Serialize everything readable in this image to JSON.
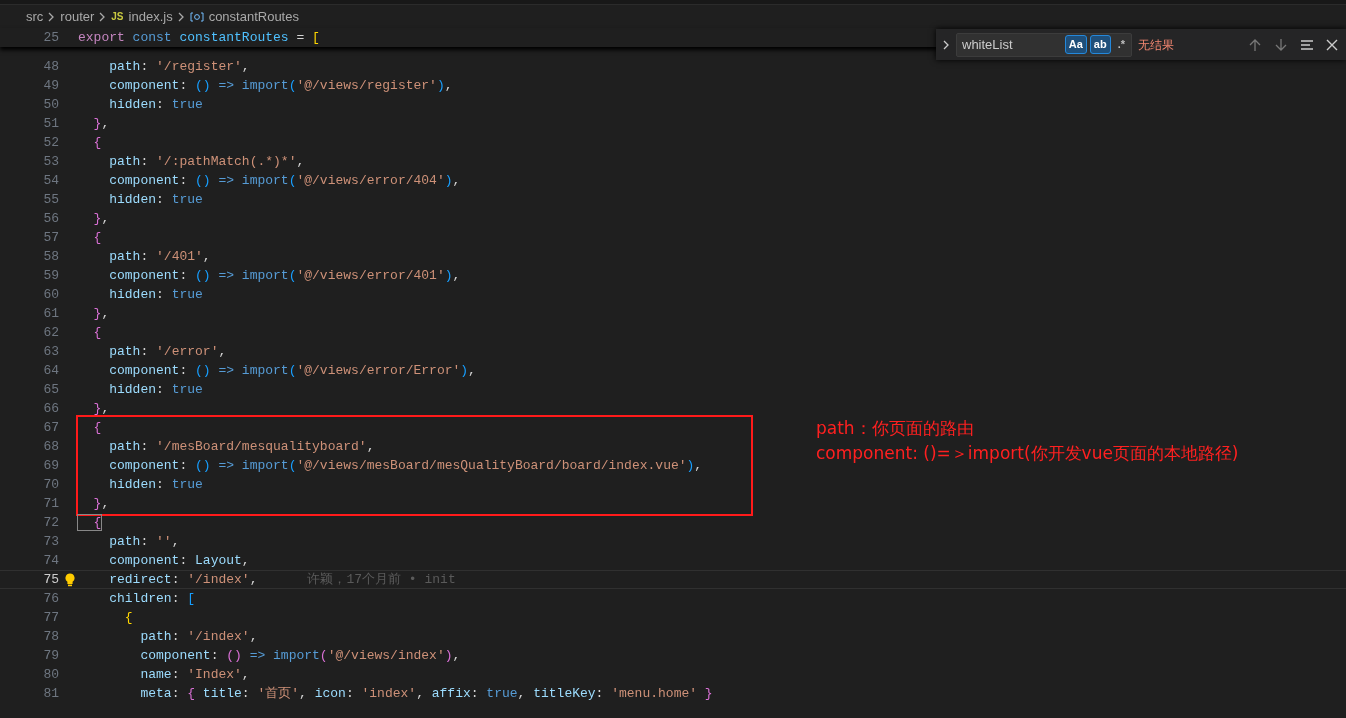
{
  "breadcrumb": [
    {
      "label": "src",
      "kind": "folder"
    },
    {
      "label": "router",
      "kind": "folder"
    },
    {
      "label": "index.js",
      "kind": "file",
      "badge": "JS"
    },
    {
      "label": "constantRoutes",
      "kind": "symbol"
    }
  ],
  "sticky_line": {
    "number": "25",
    "tokens": [
      {
        "text": "export ",
        "kind": "control"
      },
      {
        "text": "const ",
        "kind": "keyword"
      },
      {
        "text": "constantRoutes",
        "kind": "constant"
      },
      {
        "text": " = ",
        "kind": "punct"
      },
      {
        "text": "[",
        "kind": "b1"
      }
    ]
  },
  "lines": [
    {
      "number": "48",
      "tokens": [
        {
          "text": "    path",
          "kind": "prop"
        },
        {
          "text": ": ",
          "kind": "punct"
        },
        {
          "text": "'/register'",
          "kind": "str"
        },
        {
          "text": ",",
          "kind": "punct"
        }
      ]
    },
    {
      "number": "49",
      "tokens": [
        {
          "text": "    component",
          "kind": "prop"
        },
        {
          "text": ": ",
          "kind": "punct"
        },
        {
          "text": "() ",
          "kind": "b3"
        },
        {
          "text": "=> import",
          "kind": "keyword"
        },
        {
          "text": "(",
          "kind": "b3"
        },
        {
          "text": "'@/views/register'",
          "kind": "str"
        },
        {
          "text": ")",
          "kind": "b3"
        },
        {
          "text": ",",
          "kind": "punct"
        }
      ]
    },
    {
      "number": "50",
      "tokens": [
        {
          "text": "    hidden",
          "kind": "prop"
        },
        {
          "text": ": ",
          "kind": "punct"
        },
        {
          "text": "true",
          "kind": "keyword"
        }
      ]
    },
    {
      "number": "51",
      "tokens": [
        {
          "text": "  }",
          "kind": "b2"
        },
        {
          "text": ",",
          "kind": "punct"
        }
      ]
    },
    {
      "number": "52",
      "tokens": [
        {
          "text": "  {",
          "kind": "b2"
        }
      ]
    },
    {
      "number": "53",
      "tokens": [
        {
          "text": "    path",
          "kind": "prop"
        },
        {
          "text": ": ",
          "kind": "punct"
        },
        {
          "text": "'/:pathMatch(.*)*'",
          "kind": "str"
        },
        {
          "text": ",",
          "kind": "punct"
        }
      ]
    },
    {
      "number": "54",
      "tokens": [
        {
          "text": "    component",
          "kind": "prop"
        },
        {
          "text": ": ",
          "kind": "punct"
        },
        {
          "text": "() ",
          "kind": "b3"
        },
        {
          "text": "=> import",
          "kind": "keyword"
        },
        {
          "text": "(",
          "kind": "b3"
        },
        {
          "text": "'@/views/error/404'",
          "kind": "str"
        },
        {
          "text": ")",
          "kind": "b3"
        },
        {
          "text": ",",
          "kind": "punct"
        }
      ]
    },
    {
      "number": "55",
      "tokens": [
        {
          "text": "    hidden",
          "kind": "prop"
        },
        {
          "text": ": ",
          "kind": "punct"
        },
        {
          "text": "true",
          "kind": "keyword"
        }
      ]
    },
    {
      "number": "56",
      "tokens": [
        {
          "text": "  }",
          "kind": "b2"
        },
        {
          "text": ",",
          "kind": "punct"
        }
      ]
    },
    {
      "number": "57",
      "tokens": [
        {
          "text": "  {",
          "kind": "b2"
        }
      ]
    },
    {
      "number": "58",
      "tokens": [
        {
          "text": "    path",
          "kind": "prop"
        },
        {
          "text": ": ",
          "kind": "punct"
        },
        {
          "text": "'/401'",
          "kind": "str"
        },
        {
          "text": ",",
          "kind": "punct"
        }
      ]
    },
    {
      "number": "59",
      "tokens": [
        {
          "text": "    component",
          "kind": "prop"
        },
        {
          "text": ": ",
          "kind": "punct"
        },
        {
          "text": "() ",
          "kind": "b3"
        },
        {
          "text": "=> import",
          "kind": "keyword"
        },
        {
          "text": "(",
          "kind": "b3"
        },
        {
          "text": "'@/views/error/401'",
          "kind": "str"
        },
        {
          "text": ")",
          "kind": "b3"
        },
        {
          "text": ",",
          "kind": "punct"
        }
      ]
    },
    {
      "number": "60",
      "tokens": [
        {
          "text": "    hidden",
          "kind": "prop"
        },
        {
          "text": ": ",
          "kind": "punct"
        },
        {
          "text": "true",
          "kind": "keyword"
        }
      ]
    },
    {
      "number": "61",
      "tokens": [
        {
          "text": "  }",
          "kind": "b2"
        },
        {
          "text": ",",
          "kind": "punct"
        }
      ]
    },
    {
      "number": "62",
      "tokens": [
        {
          "text": "  {",
          "kind": "b2"
        }
      ]
    },
    {
      "number": "63",
      "tokens": [
        {
          "text": "    path",
          "kind": "prop"
        },
        {
          "text": ": ",
          "kind": "punct"
        },
        {
          "text": "'/error'",
          "kind": "str"
        },
        {
          "text": ",",
          "kind": "punct"
        }
      ]
    },
    {
      "number": "64",
      "tokens": [
        {
          "text": "    component",
          "kind": "prop"
        },
        {
          "text": ": ",
          "kind": "punct"
        },
        {
          "text": "() ",
          "kind": "b3"
        },
        {
          "text": "=> import",
          "kind": "keyword"
        },
        {
          "text": "(",
          "kind": "b3"
        },
        {
          "text": "'@/views/error/Error'",
          "kind": "str"
        },
        {
          "text": ")",
          "kind": "b3"
        },
        {
          "text": ",",
          "kind": "punct"
        }
      ]
    },
    {
      "number": "65",
      "tokens": [
        {
          "text": "    hidden",
          "kind": "prop"
        },
        {
          "text": ": ",
          "kind": "punct"
        },
        {
          "text": "true",
          "kind": "keyword"
        }
      ]
    },
    {
      "number": "66",
      "tokens": [
        {
          "text": "  }",
          "kind": "b2"
        },
        {
          "text": ",",
          "kind": "punct"
        }
      ]
    },
    {
      "number": "67",
      "boxed": true,
      "tokens": [
        {
          "text": "  {",
          "kind": "b2"
        }
      ]
    },
    {
      "number": "68",
      "boxed": true,
      "tokens": [
        {
          "text": "    path",
          "kind": "prop"
        },
        {
          "text": ": ",
          "kind": "punct"
        },
        {
          "text": "'/mesBoard/mesqualityboard'",
          "kind": "str"
        },
        {
          "text": ",",
          "kind": "punct"
        }
      ]
    },
    {
      "number": "69",
      "boxed": true,
      "tokens": [
        {
          "text": "    component",
          "kind": "prop"
        },
        {
          "text": ": ",
          "kind": "punct"
        },
        {
          "text": "() ",
          "kind": "b3"
        },
        {
          "text": "=> import",
          "kind": "keyword"
        },
        {
          "text": "(",
          "kind": "b3"
        },
        {
          "text": "'@/views/mesBoard/mesQualityBoard/board/index.vue'",
          "kind": "str"
        },
        {
          "text": ")",
          "kind": "b3"
        },
        {
          "text": ",",
          "kind": "punct"
        }
      ]
    },
    {
      "number": "70",
      "boxed": true,
      "tokens": [
        {
          "text": "    hidden",
          "kind": "prop"
        },
        {
          "text": ": ",
          "kind": "punct"
        },
        {
          "text": "true",
          "kind": "keyword"
        }
      ]
    },
    {
      "number": "71",
      "boxed": true,
      "tokens": [
        {
          "text": "  }",
          "kind": "b2"
        },
        {
          "text": ",",
          "kind": "punct"
        }
      ]
    },
    {
      "number": "72",
      "tokens": [
        {
          "text": "  {",
          "kind": "b2match"
        }
      ]
    },
    {
      "number": "73",
      "tokens": [
        {
          "text": "    path",
          "kind": "prop"
        },
        {
          "text": ": ",
          "kind": "punct"
        },
        {
          "text": "''",
          "kind": "str"
        },
        {
          "text": ",",
          "kind": "punct"
        }
      ]
    },
    {
      "number": "74",
      "tokens": [
        {
          "text": "    component",
          "kind": "prop"
        },
        {
          "text": ": ",
          "kind": "punct"
        },
        {
          "text": "Layout",
          "kind": "var"
        },
        {
          "text": ",",
          "kind": "punct"
        }
      ]
    },
    {
      "number": "75",
      "current": true,
      "blame": "许颖，17个月前 • init",
      "tokens": [
        {
          "text": "    redirect",
          "kind": "prop"
        },
        {
          "text": ": ",
          "kind": "punct"
        },
        {
          "text": "'/index'",
          "kind": "str"
        },
        {
          "text": ",",
          "kind": "punct"
        }
      ]
    },
    {
      "number": "76",
      "tokens": [
        {
          "text": "    children",
          "kind": "prop"
        },
        {
          "text": ": ",
          "kind": "punct"
        },
        {
          "text": "[",
          "kind": "b3"
        }
      ]
    },
    {
      "number": "77",
      "tokens": [
        {
          "text": "      {",
          "kind": "b1"
        }
      ]
    },
    {
      "number": "78",
      "tokens": [
        {
          "text": "        path",
          "kind": "prop"
        },
        {
          "text": ": ",
          "kind": "punct"
        },
        {
          "text": "'/index'",
          "kind": "str"
        },
        {
          "text": ",",
          "kind": "punct"
        }
      ]
    },
    {
      "number": "79",
      "tokens": [
        {
          "text": "        component",
          "kind": "prop"
        },
        {
          "text": ": ",
          "kind": "punct"
        },
        {
          "text": "() ",
          "kind": "b2"
        },
        {
          "text": "=> import",
          "kind": "keyword"
        },
        {
          "text": "(",
          "kind": "b2"
        },
        {
          "text": "'@/views/index'",
          "kind": "str"
        },
        {
          "text": ")",
          "kind": "b2"
        },
        {
          "text": ",",
          "kind": "punct"
        }
      ]
    },
    {
      "number": "80",
      "tokens": [
        {
          "text": "        name",
          "kind": "prop"
        },
        {
          "text": ": ",
          "kind": "punct"
        },
        {
          "text": "'Index'",
          "kind": "str"
        },
        {
          "text": ",",
          "kind": "punct"
        }
      ]
    },
    {
      "number": "81",
      "tokens": [
        {
          "text": "        meta",
          "kind": "prop"
        },
        {
          "text": ": ",
          "kind": "punct"
        },
        {
          "text": "{ ",
          "kind": "b2"
        },
        {
          "text": "title",
          "kind": "prop"
        },
        {
          "text": ": ",
          "kind": "punct"
        },
        {
          "text": "'首页'",
          "kind": "str"
        },
        {
          "text": ", ",
          "kind": "punct"
        },
        {
          "text": "icon",
          "kind": "prop"
        },
        {
          "text": ": ",
          "kind": "punct"
        },
        {
          "text": "'index'",
          "kind": "str"
        },
        {
          "text": ", ",
          "kind": "punct"
        },
        {
          "text": "affix",
          "kind": "prop"
        },
        {
          "text": ": ",
          "kind": "punct"
        },
        {
          "text": "true",
          "kind": "keyword"
        },
        {
          "text": ", ",
          "kind": "punct"
        },
        {
          "text": "titleKey",
          "kind": "prop"
        },
        {
          "text": ": ",
          "kind": "punct"
        },
        {
          "text": "'menu.home'",
          "kind": "str"
        },
        {
          "text": " }",
          "kind": "b2"
        }
      ]
    }
  ],
  "annotation": [
    "path：你页面的路由",
    "component: ()=＞import(你开发vue页面的本地路径)"
  ],
  "find": {
    "value": "whiteList",
    "options": [
      {
        "label": "Aa",
        "on": true
      },
      {
        "label": "ab",
        "on": true
      },
      {
        "label": ".*",
        "on": false
      }
    ],
    "result": "无结果"
  }
}
